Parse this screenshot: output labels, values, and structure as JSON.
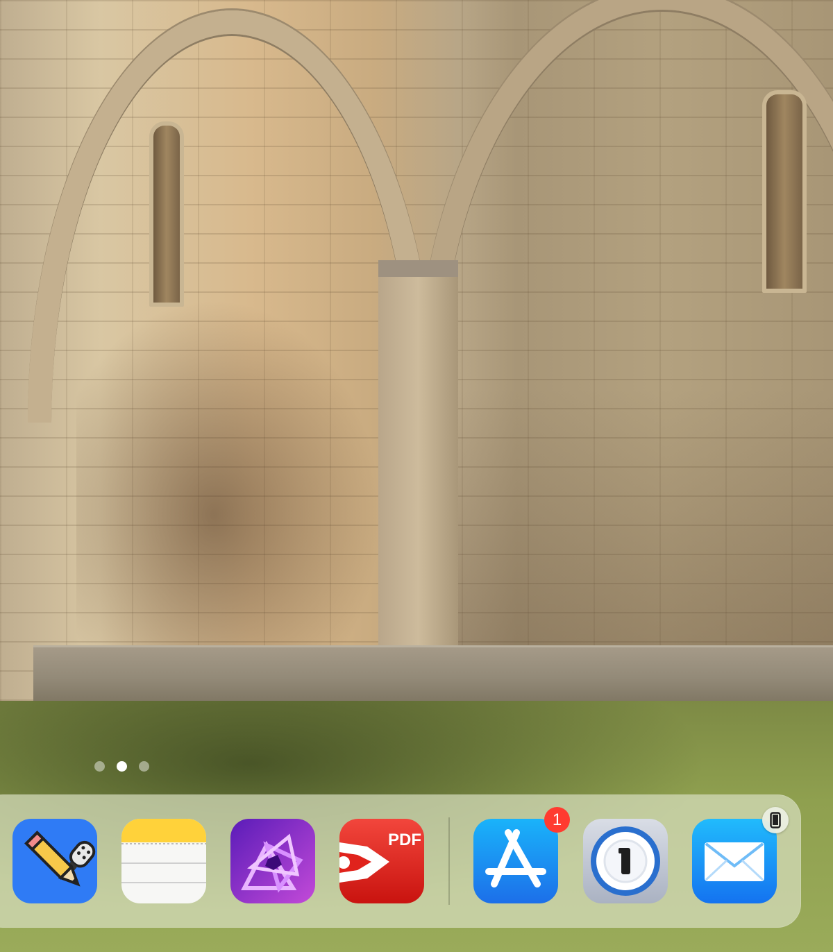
{
  "wallpaper": {
    "subject": "stone-church-apse-on-lawn"
  },
  "page_indicator": {
    "count": 3,
    "active_index": 1
  },
  "dock": {
    "apps": [
      {
        "id": "notability",
        "icon": "notability-icon",
        "color": "#2f7bf5"
      },
      {
        "id": "notes",
        "icon": "notes-icon",
        "color": "#ffd60a"
      },
      {
        "id": "affinity-photo",
        "icon": "affinity-photo-icon",
        "color": "#7c2bd6"
      },
      {
        "id": "pdf-expert",
        "icon": "pdf-expert-icon",
        "color": "#e0231c",
        "label": "PDF"
      },
      {
        "id": "app-store",
        "icon": "app-store-icon",
        "color": "#1c8cf2",
        "badge": "1"
      },
      {
        "id": "1password",
        "icon": "1password-icon",
        "color": "#2f79d6"
      },
      {
        "id": "mail",
        "icon": "mail-icon",
        "color": "#1a93f7"
      }
    ],
    "recent_apps_start_index": 4
  },
  "colors": {
    "badge": "#ff3b30",
    "dock_background": "#d7deb8"
  }
}
